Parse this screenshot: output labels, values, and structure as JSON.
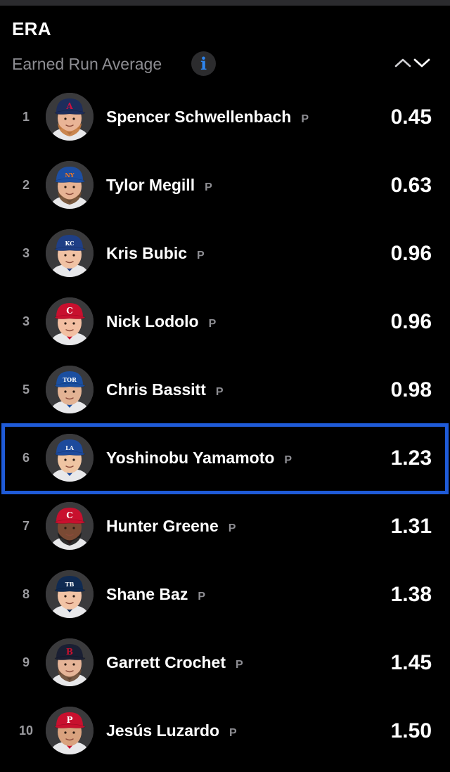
{
  "header": {
    "title": "ERA",
    "subtitle": "Earned Run Average",
    "info_icon": "info-icon",
    "sort_icon": "chevron-up-down-icon"
  },
  "colors": {
    "accent": "#2e86f0",
    "highlight_border": "#1f5bd8",
    "background": "#000000",
    "muted_text": "#8e8e93"
  },
  "players": [
    {
      "rank": "1",
      "name": "Spencer Schwellenbach",
      "position": "P",
      "value": "0.45",
      "cap_color": "#1d2d5c",
      "cap_logo": "A",
      "logo_color": "#ce1141",
      "skin": "#e9b496",
      "hair": "#c67b3e",
      "beard": true
    },
    {
      "rank": "2",
      "name": "Tylor Megill",
      "position": "P",
      "value": "0.63",
      "cap_color": "#1d4fa3",
      "cap_logo": "NY",
      "logo_color": "#ff7a1a",
      "skin": "#e6b394",
      "hair": "#6e4a2e",
      "beard": true
    },
    {
      "rank": "3",
      "name": "Kris Bubic",
      "position": "P",
      "value": "0.96",
      "cap_color": "#1f3f86",
      "cap_logo": "KC",
      "logo_color": "#ffffff",
      "skin": "#f0c2a4",
      "hair": "#6a4b35",
      "beard": false
    },
    {
      "rank": "3",
      "name": "Nick Lodolo",
      "position": "P",
      "value": "0.96",
      "cap_color": "#c8102e",
      "cap_logo": "C",
      "logo_color": "#ffffff",
      "skin": "#f2bfa2",
      "hair": "#8b5a35",
      "beard": false
    },
    {
      "rank": "5",
      "name": "Chris Bassitt",
      "position": "P",
      "value": "0.98",
      "cap_color": "#1b4fa0",
      "cap_logo": "TOR",
      "logo_color": "#ffffff",
      "skin": "#e3b394",
      "hair": "#5e4330",
      "beard": false
    },
    {
      "rank": "6",
      "name": "Yoshinobu Yamamoto",
      "position": "P",
      "value": "1.23",
      "cap_color": "#1d4a9c",
      "cap_logo": "LA",
      "logo_color": "#ffffff",
      "skin": "#efc4a2",
      "hair": "#1c1c1c",
      "beard": false
    },
    {
      "rank": "7",
      "name": "Hunter Greene",
      "position": "P",
      "value": "1.31",
      "cap_color": "#c8102e",
      "cap_logo": "C",
      "logo_color": "#ffffff",
      "skin": "#7a4a34",
      "hair": "#1a1a1a",
      "beard": true
    },
    {
      "rank": "8",
      "name": "Shane Baz",
      "position": "P",
      "value": "1.38",
      "cap_color": "#0f2a52",
      "cap_logo": "TB",
      "logo_color": "#ffffff",
      "skin": "#f2c4a6",
      "hair": "#c69a6a",
      "beard": false
    },
    {
      "rank": "9",
      "name": "Garrett Crochet",
      "position": "P",
      "value": "1.45",
      "cap_color": "#1a1f33",
      "cap_logo": "B",
      "logo_color": "#c8102e",
      "skin": "#e5b497",
      "hair": "#6a4a33",
      "beard": true
    },
    {
      "rank": "10",
      "name": "Jesús Luzardo",
      "position": "P",
      "value": "1.50",
      "cap_color": "#c8102e",
      "cap_logo": "P",
      "logo_color": "#ffffff",
      "skin": "#d9a27e",
      "hair": "#1a1a1a",
      "beard": false
    }
  ],
  "selected_rank_index": 5
}
